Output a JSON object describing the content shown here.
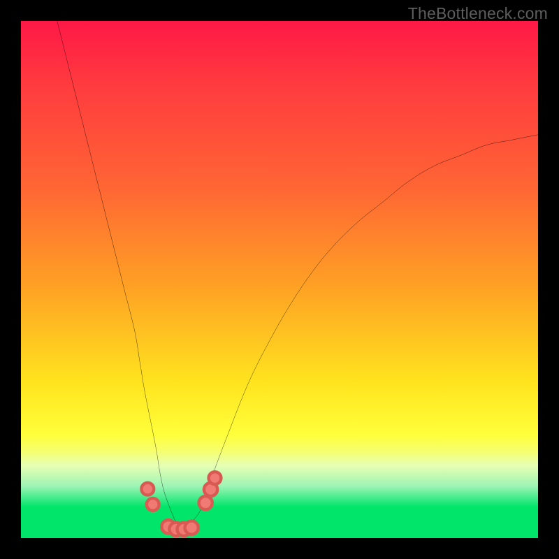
{
  "watermark": "TheBottleneck.com",
  "chart_data": {
    "type": "line",
    "title": "",
    "xlabel": "",
    "ylabel": "",
    "xlim": [
      0,
      100
    ],
    "ylim": [
      0,
      100
    ],
    "legend": false,
    "series": [
      {
        "name": "curve",
        "x": [
          7,
          8,
          10,
          12,
          14,
          16,
          18,
          20,
          22,
          23,
          24,
          26,
          27,
          28,
          30,
          31,
          32,
          33,
          35,
          37,
          40,
          44,
          48,
          52,
          56,
          60,
          65,
          70,
          75,
          80,
          85,
          90,
          95,
          100
        ],
        "values": [
          100,
          96,
          88,
          80,
          72,
          64,
          56,
          48,
          40,
          34,
          28,
          18,
          12,
          8,
          3,
          2,
          2,
          3,
          6,
          12,
          20,
          30,
          38,
          45,
          51,
          56,
          61,
          65,
          69,
          72,
          74,
          76,
          77,
          78
        ]
      }
    ],
    "markers": [
      {
        "x": 24.5,
        "y": 9.5,
        "r": 1.2
      },
      {
        "x": 25.5,
        "y": 6.5,
        "r": 1.2
      },
      {
        "x": 28.5,
        "y": 2.2,
        "r": 1.3
      },
      {
        "x": 30.0,
        "y": 1.7,
        "r": 1.3
      },
      {
        "x": 31.5,
        "y": 1.7,
        "r": 1.3
      },
      {
        "x": 33.0,
        "y": 2.0,
        "r": 1.3
      },
      {
        "x": 35.7,
        "y": 6.8,
        "r": 1.3
      },
      {
        "x": 36.7,
        "y": 9.4,
        "r": 1.3
      },
      {
        "x": 37.5,
        "y": 11.6,
        "r": 1.2
      }
    ]
  },
  "colors": {
    "curve": "#000000",
    "bead_fill": "#ef7b74",
    "bead_stroke": "#d85a52",
    "gradient_top": "#ff1846",
    "gradient_bottom": "#00e56a"
  }
}
